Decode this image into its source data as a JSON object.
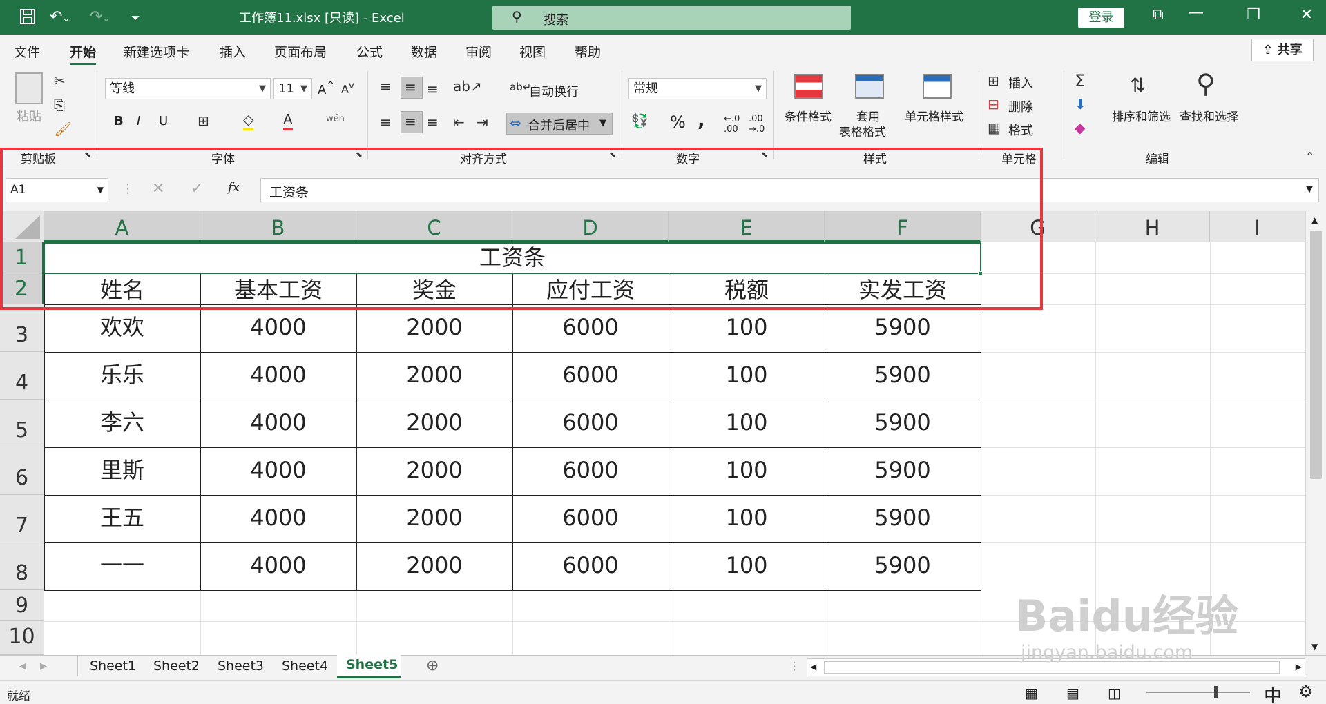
{
  "titlebar": {
    "save_icon": "save-icon",
    "undo_icon": "undo-icon",
    "redo_icon": "redo-icon",
    "title": "工作簿11.xlsx [只读] - Excel",
    "search_placeholder": "搜索",
    "login_label": "登录"
  },
  "ribbon_tabs": [
    "文件",
    "开始",
    "新建选项卡",
    "插入",
    "页面布局",
    "公式",
    "数据",
    "审阅",
    "视图",
    "帮助"
  ],
  "share_label": "共享",
  "clipboard": {
    "paste_label": "粘贴",
    "group_label": "剪贴板"
  },
  "font": {
    "name": "等线",
    "size": "11",
    "group_label": "字体",
    "bold": "B",
    "italic": "I",
    "underline": "U"
  },
  "alignment": {
    "wrap_label": "自动换行",
    "merge_label": "合并后居中",
    "group_label": "对齐方式"
  },
  "number": {
    "format": "常规",
    "group_label": "数字",
    "percent": "%",
    "comma": ","
  },
  "styles": {
    "conditional_label": "条件格式",
    "table_label_1": "套用",
    "table_label_2": "表格格式",
    "cell_style_label": "单元格样式",
    "group_label": "样式"
  },
  "cells": {
    "insert_label": "插入",
    "delete_label": "删除",
    "format_label": "格式",
    "group_label": "单元格"
  },
  "editing": {
    "sort_label": "排序和筛选",
    "find_label": "查找和选择",
    "group_label": "编辑"
  },
  "formula_bar": {
    "name_box": "A1",
    "fx": "fx",
    "value": "工资条"
  },
  "columns": [
    "A",
    "B",
    "C",
    "D",
    "E",
    "F",
    "G",
    "H",
    "I"
  ],
  "rows": [
    "1",
    "2",
    "3",
    "4",
    "5",
    "6",
    "7",
    "8",
    "9",
    "10"
  ],
  "sheet": {
    "title": "工资条",
    "headers": [
      "姓名",
      "基本工资",
      "奖金",
      "应付工资",
      "税额",
      "实发工资"
    ],
    "data": [
      [
        "欢欢",
        "4000",
        "2000",
        "6000",
        "100",
        "5900"
      ],
      [
        "乐乐",
        "4000",
        "2000",
        "6000",
        "100",
        "5900"
      ],
      [
        "李六",
        "4000",
        "2000",
        "6000",
        "100",
        "5900"
      ],
      [
        "里斯",
        "4000",
        "2000",
        "6000",
        "100",
        "5900"
      ],
      [
        "王五",
        "4000",
        "2000",
        "6000",
        "100",
        "5900"
      ],
      [
        "一一",
        "4000",
        "2000",
        "6000",
        "100",
        "5900"
      ]
    ]
  },
  "sheet_tabs": [
    "Sheet1",
    "Sheet2",
    "Sheet3",
    "Sheet4",
    "Sheet5"
  ],
  "active_sheet": "Sheet5",
  "status": {
    "ready": "就绪",
    "ime": "中"
  },
  "watermark": {
    "main": "Baidu经验",
    "url": "jingyan.baidu.com"
  }
}
